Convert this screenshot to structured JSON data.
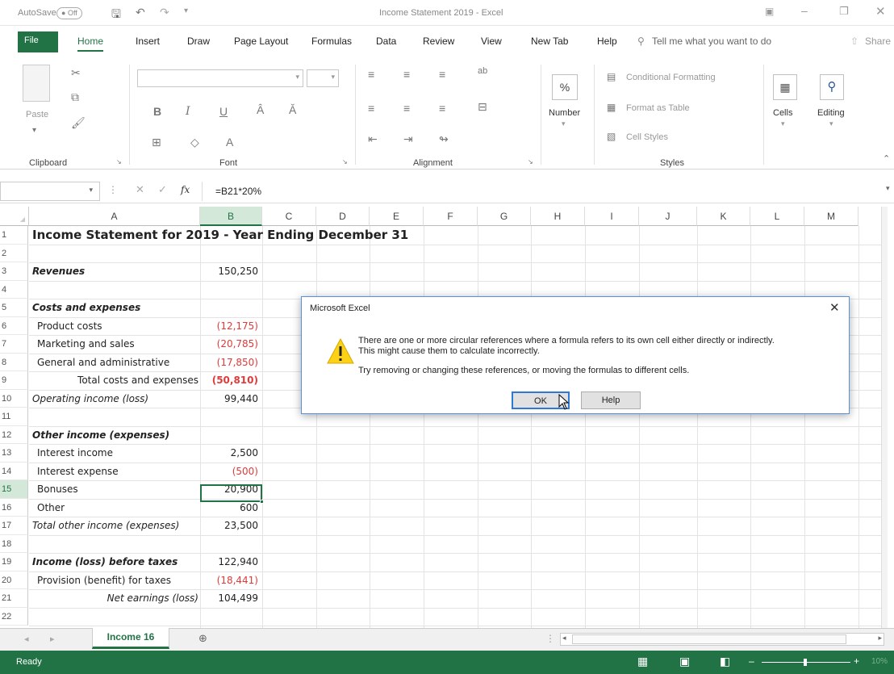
{
  "titlebar": {
    "autosave_label": "AutoSave",
    "autosave_state": "Off",
    "title": "Income Statement 2019  -  Excel"
  },
  "tabs": {
    "file": "File",
    "home": "Home",
    "insert": "Insert",
    "draw": "Draw",
    "page_layout": "Page Layout",
    "formulas": "Formulas",
    "data": "Data",
    "review": "Review",
    "view": "View",
    "new_tab": "New Tab",
    "help": "Help",
    "tell_me": "Tell me what you want to do",
    "share": "Share"
  },
  "ribbon": {
    "paste": "Paste",
    "clipboard": "Clipboard",
    "font": "Font",
    "alignment": "Alignment",
    "number": "Number",
    "number_label": "Number",
    "conditional_formatting": "Conditional Formatting",
    "format_as_table": "Format as Table",
    "cell_styles": "Cell Styles",
    "styles": "Styles",
    "cells": "Cells",
    "editing": "Editing"
  },
  "formula_bar": {
    "fx": "fx",
    "formula": "=B21*20%"
  },
  "columns": [
    "A",
    "B",
    "C",
    "D",
    "E",
    "F",
    "G",
    "H",
    "I",
    "J",
    "K",
    "L",
    "M"
  ],
  "rows": [
    {
      "num": "1",
      "a": "Income Statement for 2019 - Year Ending December 31",
      "b": ""
    },
    {
      "num": "2",
      "a": "",
      "b": ""
    },
    {
      "num": "3",
      "a": "Revenues",
      "b": "150,250"
    },
    {
      "num": "4",
      "a": "",
      "b": ""
    },
    {
      "num": "5",
      "a": "Costs and expenses",
      "b": ""
    },
    {
      "num": "6",
      "a": "Product costs",
      "b": "(12,175)"
    },
    {
      "num": "7",
      "a": "Marketing and sales",
      "b": "(20,785)"
    },
    {
      "num": "8",
      "a": "General and administrative",
      "b": "(17,850)"
    },
    {
      "num": "9",
      "a": "Total costs and expenses",
      "b": "(50,810)"
    },
    {
      "num": "10",
      "a": "Operating income (loss)",
      "b": "99,440"
    },
    {
      "num": "11",
      "a": "",
      "b": ""
    },
    {
      "num": "12",
      "a": "Other income (expenses)",
      "b": ""
    },
    {
      "num": "13",
      "a": "Interest income",
      "b": "2,500"
    },
    {
      "num": "14",
      "a": "Interest expense",
      "b": "(500)"
    },
    {
      "num": "15",
      "a": "Bonuses",
      "b": "20,900"
    },
    {
      "num": "16",
      "a": "Other",
      "b": "600"
    },
    {
      "num": "17",
      "a": "Total other income (expenses)",
      "b": "23,500"
    },
    {
      "num": "18",
      "a": "",
      "b": ""
    },
    {
      "num": "19",
      "a": "Income (loss) before taxes",
      "b": "122,940"
    },
    {
      "num": "20",
      "a": "Provision (benefit) for taxes",
      "b": "(18,441)"
    },
    {
      "num": "21",
      "a": "Net earnings (loss)",
      "b": "104,499"
    },
    {
      "num": "22",
      "a": "",
      "b": ""
    }
  ],
  "sheet": {
    "tab": "Income 16"
  },
  "status": {
    "ready": "Ready",
    "zoom": "10%"
  },
  "dialog": {
    "title": "Microsoft Excel",
    "line1": "There are one or more circular references where a formula refers to its own cell either directly or indirectly.",
    "line2": "This might cause them to calculate incorrectly.",
    "line3": "Try removing or changing these references, or moving the formulas to different cells.",
    "ok": "OK",
    "help": "Help"
  },
  "colors": {
    "excel_green": "#217346",
    "negative_red": "#e03a3a"
  }
}
